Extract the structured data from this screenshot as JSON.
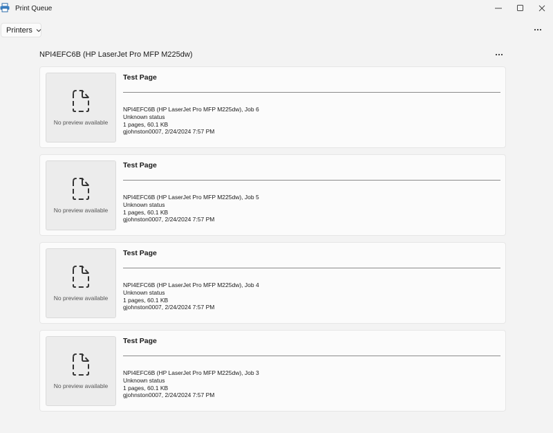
{
  "window": {
    "title": "Print Queue",
    "minimize_glyph": "—",
    "maximize_glyph": "☐",
    "close_glyph": "✕"
  },
  "toolbar": {
    "printers_label": "Printers",
    "more_icon": "more-icon"
  },
  "printer": {
    "name": "NPI4EFC6B (HP LaserJet Pro MFP M225dw)"
  },
  "jobs": [
    {
      "title": "Test Page",
      "preview_text": "No preview available",
      "job_line": "NPI4EFC6B (HP LaserJet Pro MFP M225dw), Job 6",
      "status": "Unknown status",
      "size": "1 pages, 60.1 KB",
      "owner_time": "gjohnston0007, 2/24/2024 7:57 PM"
    },
    {
      "title": "Test Page",
      "preview_text": "No preview available",
      "job_line": "NPI4EFC6B (HP LaserJet Pro MFP M225dw), Job 5",
      "status": "Unknown status",
      "size": "1 pages, 60.1 KB",
      "owner_time": "gjohnston0007, 2/24/2024 7:57 PM"
    },
    {
      "title": "Test Page",
      "preview_text": "No preview available",
      "job_line": "NPI4EFC6B (HP LaserJet Pro MFP M225dw), Job 4",
      "status": "Unknown status",
      "size": "1 pages, 60.1 KB",
      "owner_time": "gjohnston0007, 2/24/2024 7:57 PM"
    },
    {
      "title": "Test Page",
      "preview_text": "No preview available",
      "job_line": "NPI4EFC6B (HP LaserJet Pro MFP M225dw), Job 3",
      "status": "Unknown status",
      "size": "1 pages, 60.1 KB",
      "owner_time": "gjohnston0007, 2/24/2024 7:57 PM"
    }
  ],
  "colors": {
    "background": "#f3f3f3",
    "card": "#fbfbfb",
    "preview": "#ececec"
  }
}
